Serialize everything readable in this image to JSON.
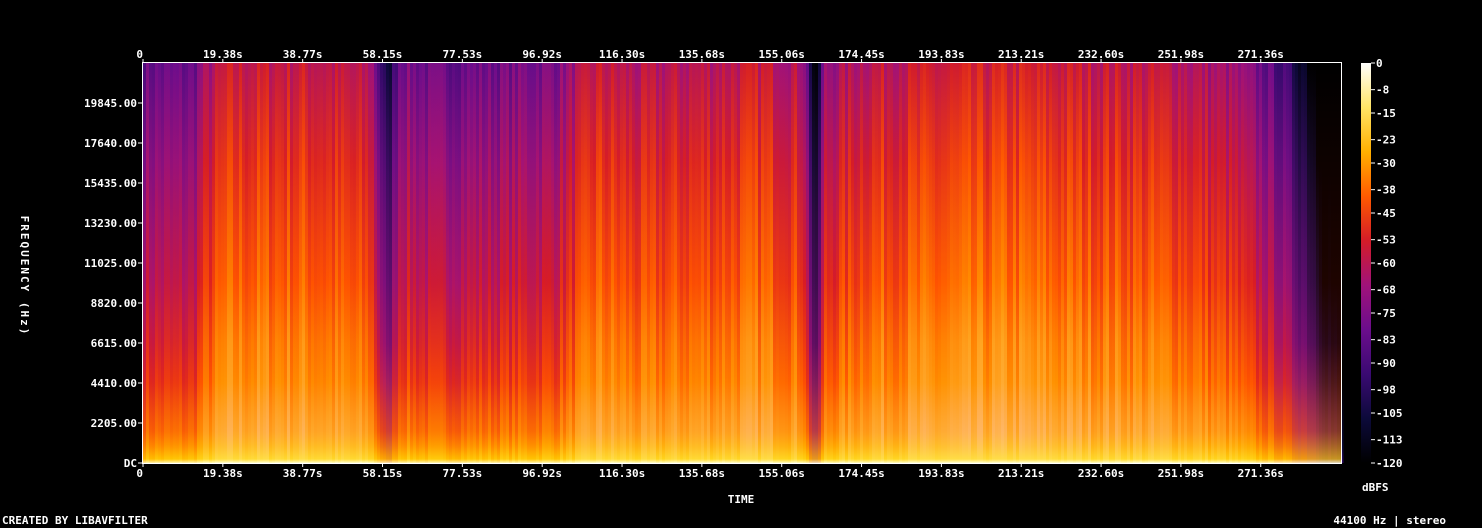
{
  "chart_data": {
    "type": "heatmap",
    "title": "",
    "xlabel": "TIME",
    "ylabel": "FREQUENCY (Hz)",
    "colorbar_label": "dBFS",
    "x_ticks": [
      "0",
      "19.38s",
      "38.77s",
      "58.15s",
      "77.53s",
      "96.92s",
      "116.30s",
      "135.68s",
      "155.06s",
      "174.45s",
      "193.83s",
      "213.21s",
      "232.60s",
      "251.98s",
      "271.36s"
    ],
    "y_ticks": [
      "DC",
      "2205.00",
      "4410.00",
      "6615.00",
      "8820.00",
      "11025.00",
      "13230.00",
      "15435.00",
      "17640.00",
      "19845.00"
    ],
    "colorbar_ticks": [
      "0",
      "-8",
      "-15",
      "-23",
      "-30",
      "-38",
      "-45",
      "-53",
      "-60",
      "-68",
      "-75",
      "-83",
      "-90",
      "-98",
      "-105",
      "-113",
      "-120"
    ],
    "xlim": [
      0,
      290.8
    ],
    "ylim": [
      0,
      22050
    ],
    "zlim": [
      -120,
      0
    ],
    "colormap": [
      "#000000",
      "#0c0a3a",
      "#3a0a72",
      "#6b0d8c",
      "#a0127a",
      "#d41c28",
      "#ff5a00",
      "#ffb000",
      "#ffe566",
      "#ffffff"
    ],
    "energy_profile": {
      "time_s": [
        0,
        3,
        12,
        14,
        20,
        40,
        55,
        59,
        62,
        70,
        85,
        100,
        110,
        120,
        140,
        150,
        160,
        163,
        165,
        175,
        190,
        210,
        230,
        250,
        265,
        275,
        282,
        288,
        290.8
      ],
      "level": [
        0.7,
        0.7,
        0.7,
        0.8,
        0.9,
        0.9,
        0.85,
        0.45,
        0.75,
        0.7,
        0.72,
        0.75,
        0.9,
        0.85,
        0.88,
        0.9,
        0.85,
        0.3,
        0.8,
        0.88,
        0.9,
        0.92,
        0.9,
        0.88,
        0.8,
        0.65,
        0.45,
        0.2,
        0.1
      ]
    }
  },
  "footer": {
    "credit": "CREATED BY LIBAVFILTER",
    "format": "44100 Hz | stereo"
  }
}
